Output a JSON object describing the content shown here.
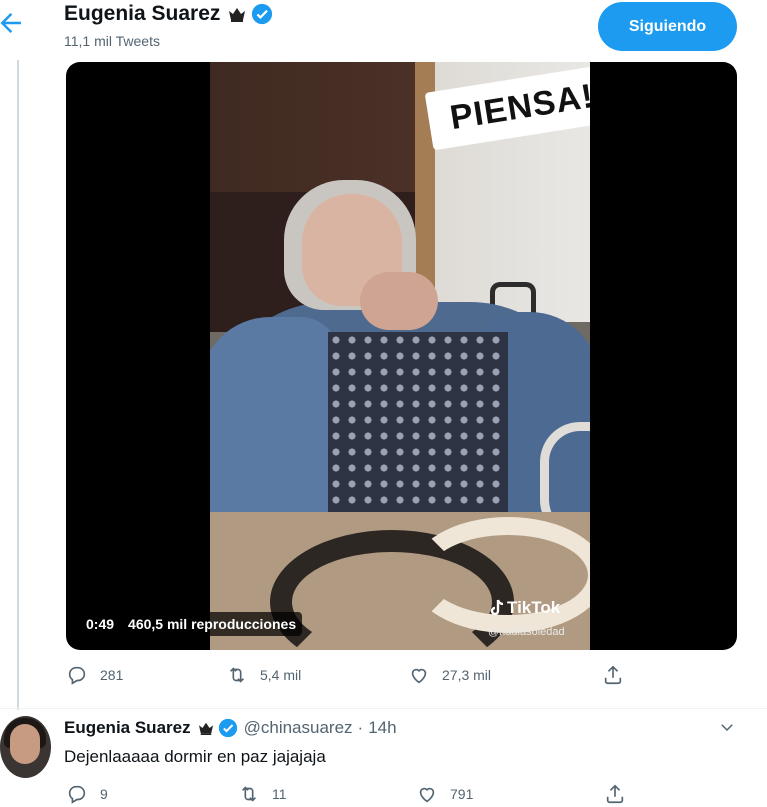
{
  "header": {
    "name": "Eugenia Suarez",
    "tweet_count": "11,1 mil Tweets",
    "follow_label": "Siguiendo"
  },
  "video": {
    "overlay_text": "PIENSA!",
    "duration": "0:49",
    "views": "460,5 mil reproducciones",
    "tiktok_label": "TikTok",
    "tiktok_handle": "@nadiasoledad"
  },
  "tweet_actions": {
    "replies": "281",
    "retweets": "5,4 mil",
    "likes": "27,3 mil"
  },
  "reply": {
    "name": "Eugenia Suarez",
    "handle": "@chinasuarez",
    "separator": "·",
    "time": "14h",
    "text": "Dejenlaaaaa dormir en paz jajajaja",
    "replies": "9",
    "retweets": "11",
    "likes": "791"
  },
  "colors": {
    "accent": "#1d9bf0",
    "secondary_text": "#536471"
  }
}
